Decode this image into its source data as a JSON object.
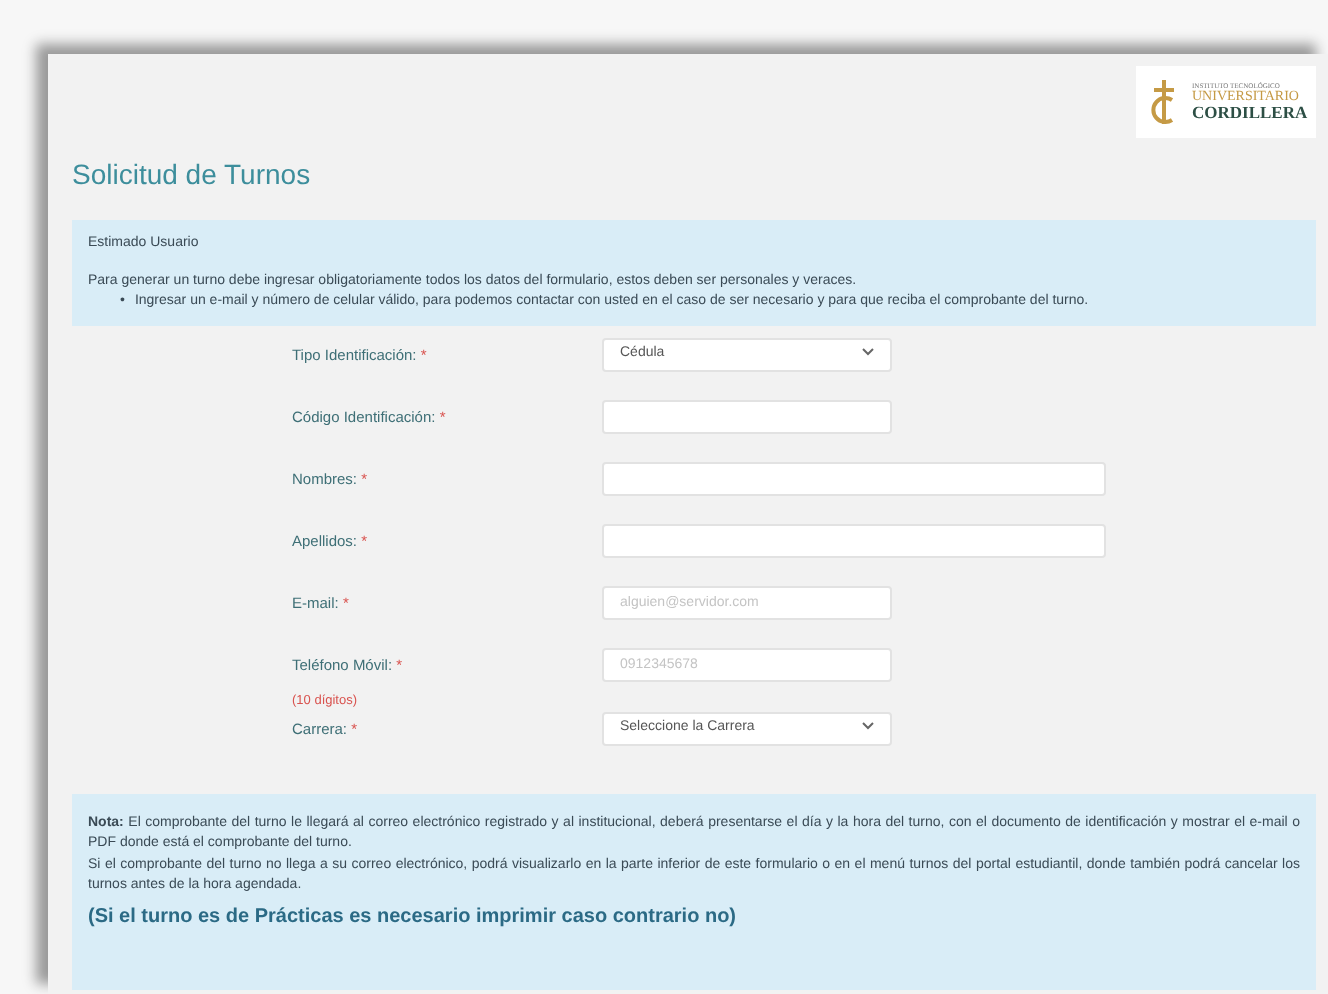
{
  "logo": {
    "line_1": "INSTITUTO TECNOLÓGICO",
    "line_2": "UNIVERSITARIO",
    "line_3": "CORDILLERA"
  },
  "title": "Solicitud de Turnos",
  "info": {
    "heading": "Estimado Usuario",
    "text": "Para generar un turno debe ingresar obligatoriamente todos los datos del formulario, estos deben ser personales y veraces.",
    "bullets": [
      {
        "marker": "•",
        "text": "Ingresar un e-mail y número de celular válido, para podemos contactar con usted en el caso de ser necesario y para que reciba el comprobante del turno."
      }
    ]
  },
  "fields": [
    {
      "label": "Tipo Identificación:",
      "required_mark": "*",
      "kind": "select",
      "value": "Cédula"
    },
    {
      "label": "Código Identificación:",
      "required_mark": "*",
      "kind": "text"
    },
    {
      "label": "Nombres:",
      "required_mark": "*",
      "kind": "wide"
    },
    {
      "label": "Apellidos:",
      "required_mark": "*",
      "kind": "wide"
    },
    {
      "label": "E-mail:",
      "required_mark": "*",
      "kind": "text",
      "placeholder": "alguien@servidor.com"
    },
    {
      "label": "Teléfono Móvil:",
      "required_mark": "*",
      "kind": "text",
      "placeholder": "0912345678",
      "hint": "(10 dígitos)"
    },
    {
      "label": "Carrera:",
      "required_mark": "*",
      "kind": "select",
      "value": "Seleccione la Carrera"
    }
  ],
  "note": {
    "paragraphs": [
      "**Nota:** El comprobante del turno le llegará al correo electrónico registrado y al institucional, deberá presentarse el día y la hora del turno, con el documento de identificación y mostrar el e-mail o PDF donde está el comprobante del turno.",
      "Si el comprobante del turno no llega a su correo electrónico, podrá visualizarlo en la parte inferior de este formulario o en el menú turnos del portal estudiantil, donde también podrá cancelar los turnos antes de la hora agendada."
    ],
    "emphasis": "(Si el turno es de Prácticas es necesario imprimir caso contrario no)"
  }
}
